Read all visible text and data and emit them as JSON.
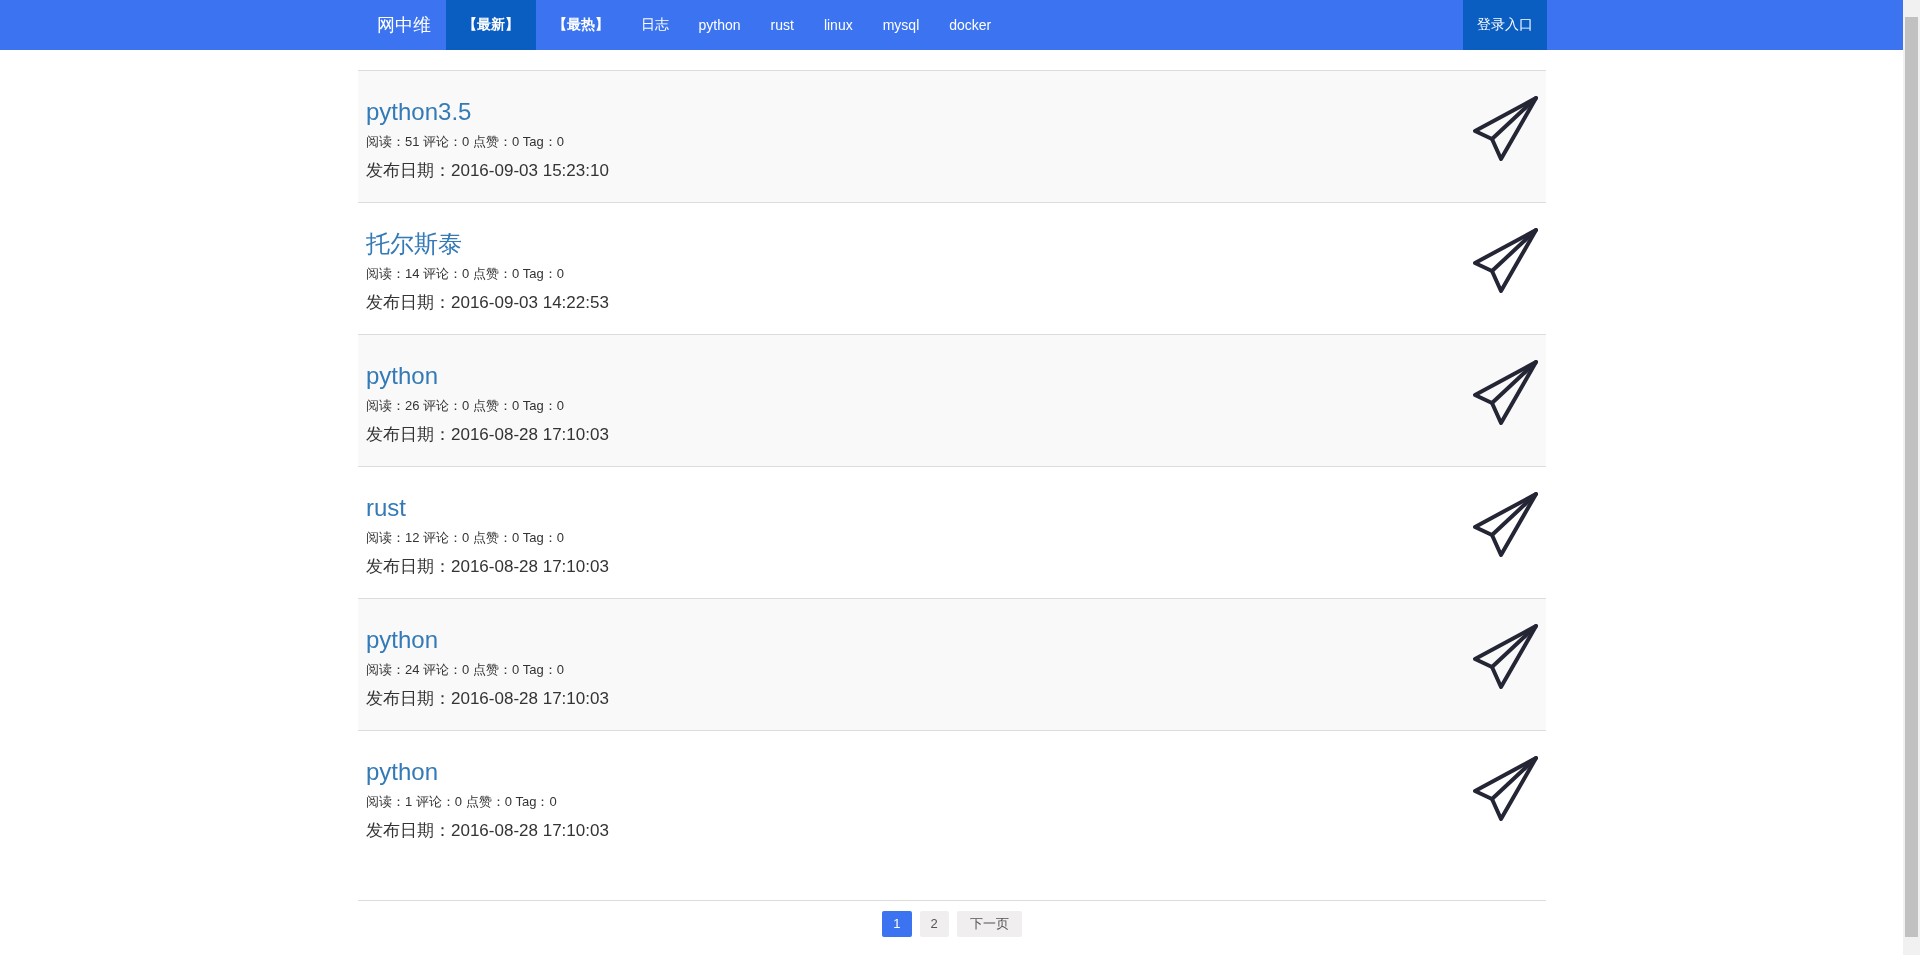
{
  "navbar": {
    "brand": "网中维",
    "items": [
      {
        "label": "【最新】",
        "selected": true
      },
      {
        "label": "【最热】",
        "selected": false
      },
      {
        "label": "日志",
        "selected": false
      },
      {
        "label": "python",
        "selected": false
      },
      {
        "label": "rust",
        "selected": false
      },
      {
        "label": "linux",
        "selected": false
      },
      {
        "label": "mysql",
        "selected": false
      },
      {
        "label": "docker",
        "selected": false
      }
    ],
    "login": "登录入口"
  },
  "posts": [
    {
      "title": "python3.5",
      "meta": "阅读：51 评论：0 点赞：0 Tag：0",
      "date": "发布日期：2016-09-03 15:23:10"
    },
    {
      "title": "托尔斯泰",
      "meta": "阅读：14 评论：0 点赞：0 Tag：0",
      "date": "发布日期：2016-09-03 14:22:53"
    },
    {
      "title": "python",
      "meta": "阅读：26 评论：0 点赞：0 Tag：0",
      "date": "发布日期：2016-08-28 17:10:03"
    },
    {
      "title": "rust",
      "meta": "阅读：12 评论：0 点赞：0 Tag：0",
      "date": "发布日期：2016-08-28 17:10:03"
    },
    {
      "title": "python",
      "meta": "阅读：24 评论：0 点赞：0 Tag：0",
      "date": "发布日期：2016-08-28 17:10:03"
    },
    {
      "title": "python",
      "meta": "阅读：1 评论：0 点赞：0 Tag：0",
      "date": "发布日期：2016-08-28 17:10:03"
    }
  ],
  "pagination": {
    "pages": [
      {
        "label": "1",
        "selected": true
      },
      {
        "label": "2",
        "selected": false
      }
    ],
    "next": "下一页"
  }
}
